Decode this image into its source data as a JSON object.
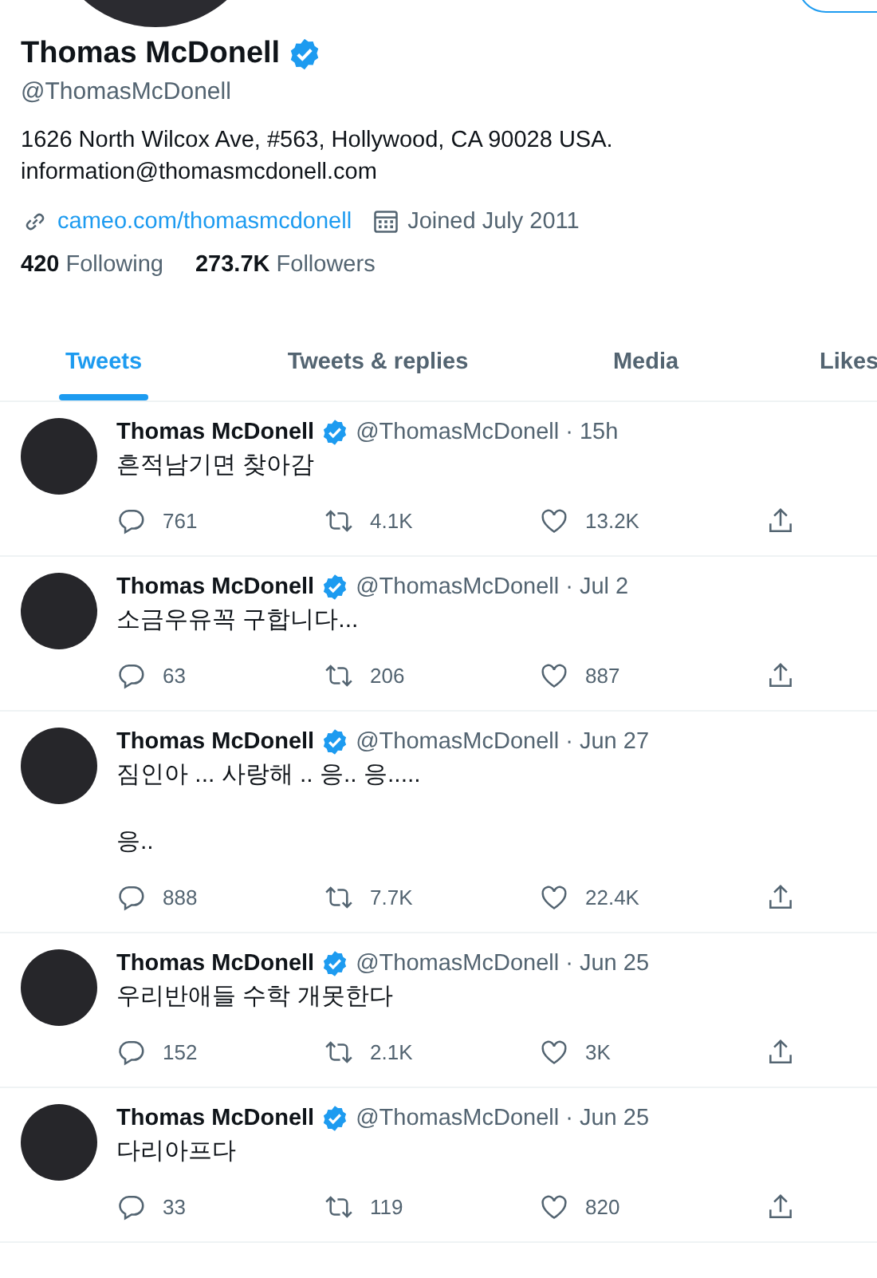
{
  "profile": {
    "name": "Thomas McDonell",
    "verified": true,
    "handle": "@ThomasMcDonell",
    "bio": "1626 North Wilcox Ave, #563, Hollywood, CA 90028 USA.\ninformation@thomasmcdonell.com",
    "website": "cameo.com/thomasmcdonell",
    "joined": "Joined July 2011",
    "following_count": "420",
    "following_label": "Following",
    "followers_count": "273.7K",
    "followers_label": "Followers"
  },
  "tabs": [
    {
      "label": "Tweets",
      "selected": true
    },
    {
      "label": "Tweets & replies",
      "selected": false
    },
    {
      "label": "Media",
      "selected": false
    },
    {
      "label": "Likes",
      "selected": false
    }
  ],
  "tweets": [
    {
      "author": "Thomas McDonell",
      "verified": true,
      "meta": "@ThomasMcDonell · 15h",
      "text": "흔적남기면 찾아감",
      "replies": "761",
      "retweets": "4.1K",
      "likes": "13.2K"
    },
    {
      "author": "Thomas McDonell",
      "verified": true,
      "meta": "@ThomasMcDonell · Jul 2",
      "text": "소금우유꼭 구합니다...",
      "replies": "63",
      "retweets": "206",
      "likes": "887"
    },
    {
      "author": "Thomas McDonell",
      "verified": true,
      "meta": "@ThomasMcDonell · Jun 27",
      "text": "짐인아 ... 사랑해 .. 응.. 응.....\n\n응..",
      "replies": "888",
      "retweets": "7.7K",
      "likes": "22.4K"
    },
    {
      "author": "Thomas McDonell",
      "verified": true,
      "meta": "@ThomasMcDonell · Jun 25",
      "text": "우리반애들 수학 개못한다",
      "replies": "152",
      "retweets": "2.1K",
      "likes": "3K"
    },
    {
      "author": "Thomas McDonell",
      "verified": true,
      "meta": "@ThomasMcDonell · Jun 25",
      "text": "다리아프다",
      "replies": "33",
      "retweets": "119",
      "likes": "820"
    }
  ]
}
